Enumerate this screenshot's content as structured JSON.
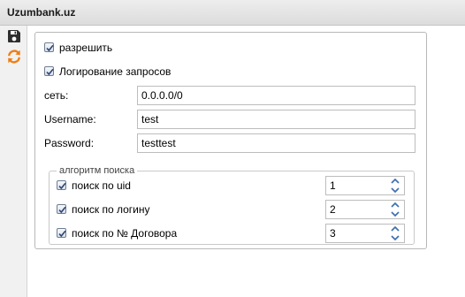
{
  "window": {
    "title": "Uzumbank.uz"
  },
  "toolbar": {
    "save_icon": "floppy-disk-icon",
    "refresh_icon": "refresh-arrows-icon",
    "refresh_color": "#f07d12",
    "save_color": "#2f2f2f"
  },
  "form": {
    "allow": {
      "label": "разрешить",
      "checked": true
    },
    "logging": {
      "label": "Логирование запросов",
      "checked": true
    },
    "network": {
      "label": "сеть:",
      "value": "0.0.0.0/0"
    },
    "username": {
      "label": "Username:",
      "value": "test"
    },
    "password": {
      "label": "Password:",
      "value": "testtest"
    }
  },
  "search_algorithm": {
    "legend": "алгоритм поиска",
    "items": [
      {
        "label": "поиск по uid",
        "checked": true,
        "value": "1"
      },
      {
        "label": "поиск по логину",
        "checked": true,
        "value": "2"
      },
      {
        "label": "поиск по № Договора",
        "checked": true,
        "value": "3"
      }
    ]
  },
  "colors": {
    "spinner_arrow": "#3d6fb3",
    "checkmark": "#2c4570"
  }
}
